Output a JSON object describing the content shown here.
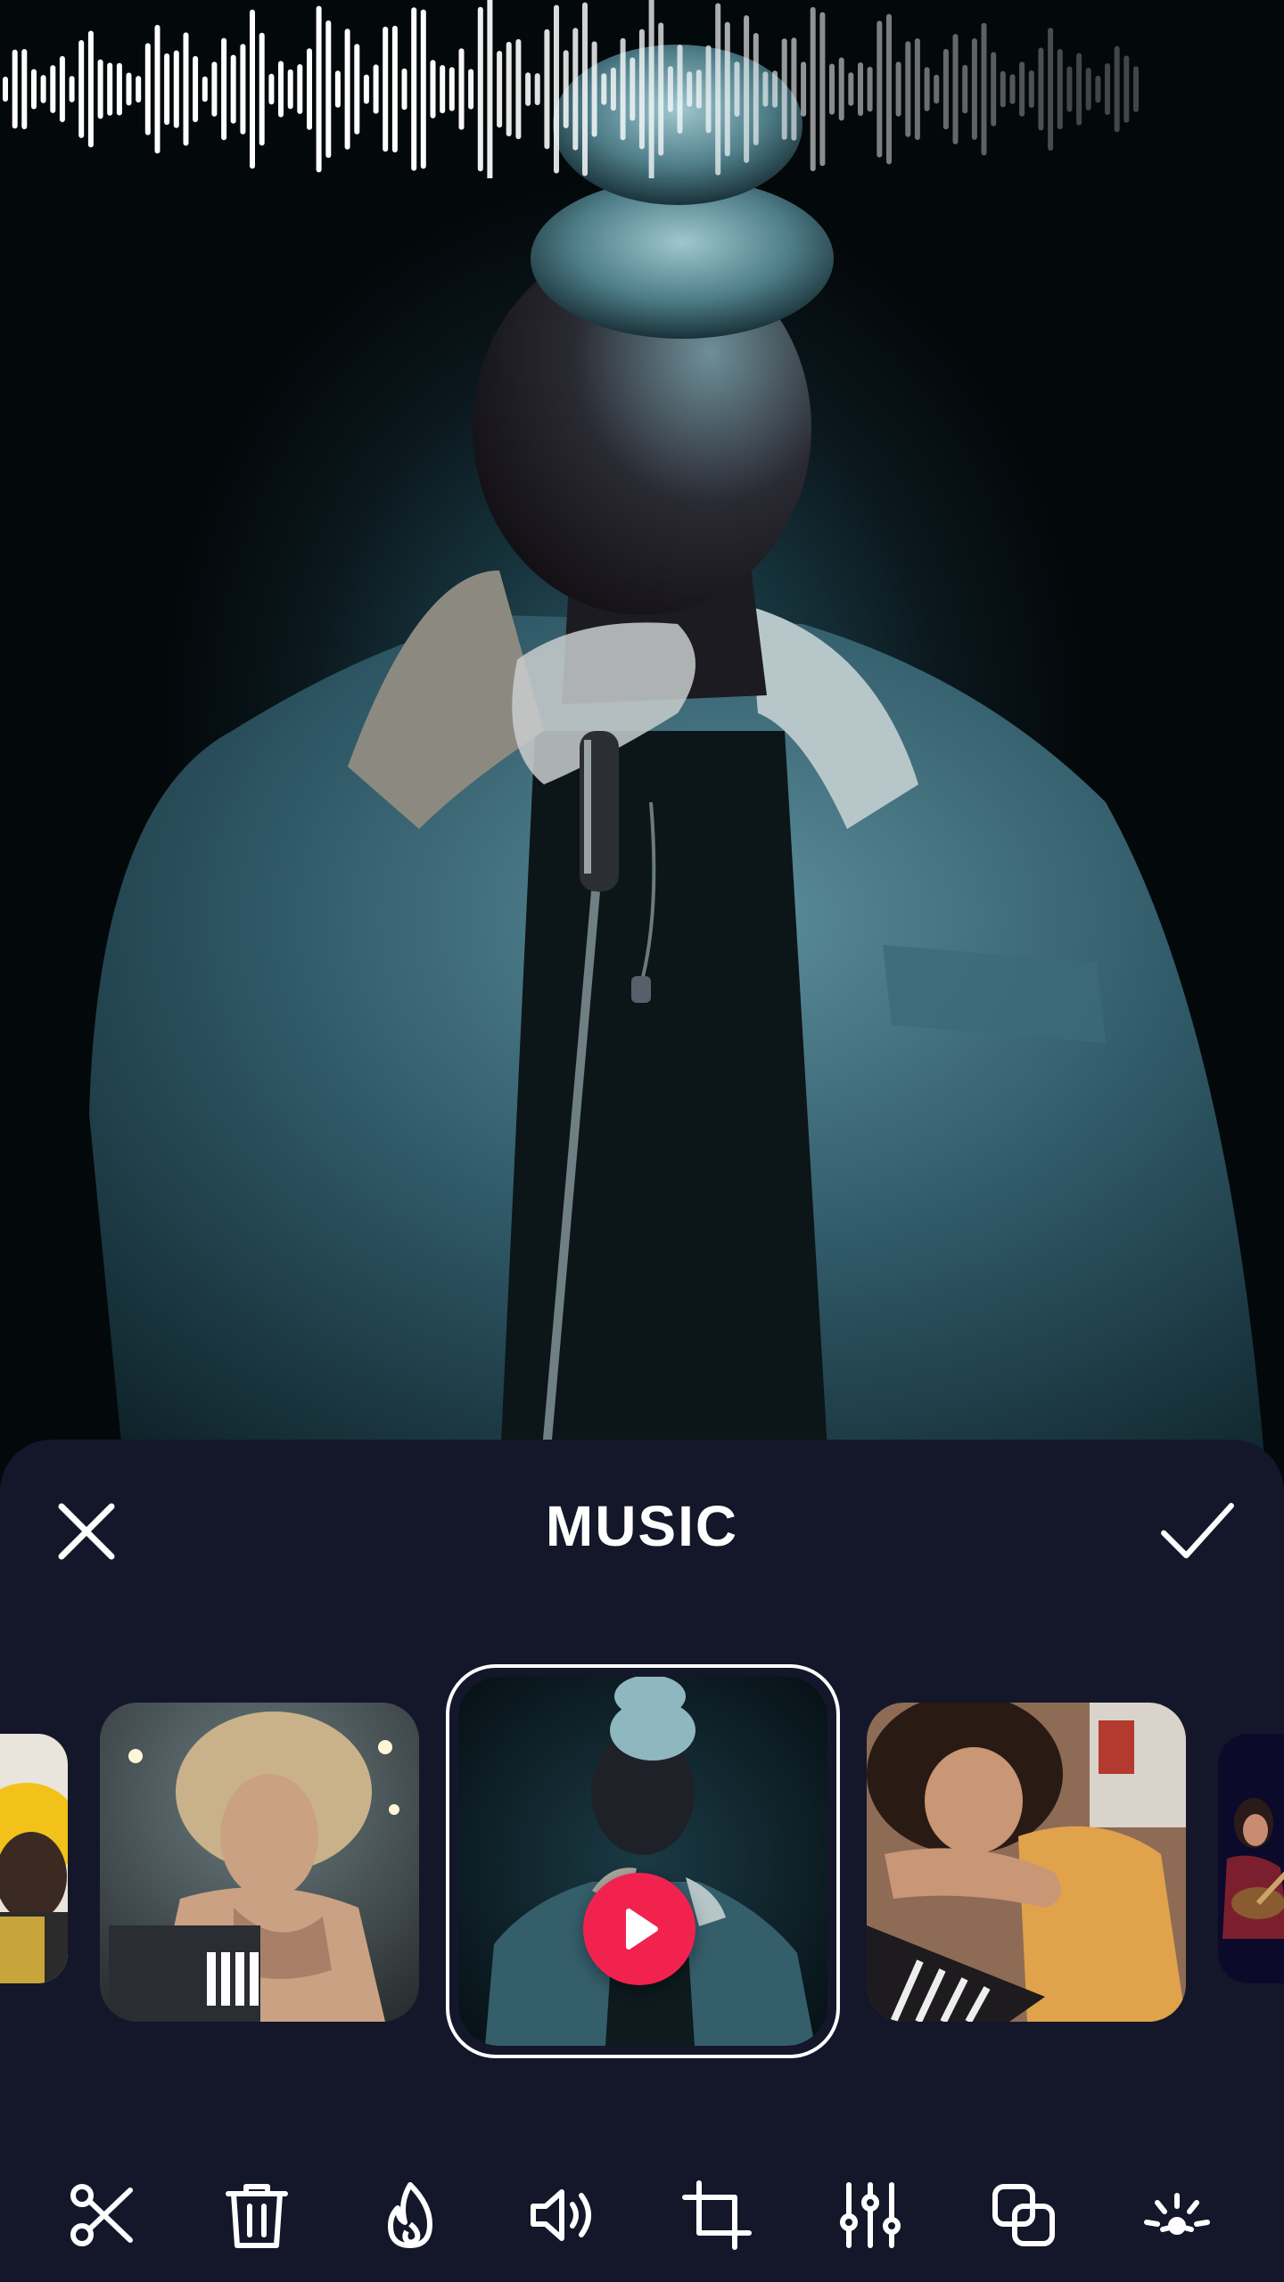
{
  "header": {
    "title": "MUSIC"
  },
  "carousel": {
    "items": [
      {
        "name": "partial-yellow-hair-thumb"
      },
      {
        "name": "curly-hair-woman-thumb"
      },
      {
        "name": "singer-microphone-thumb",
        "selected": true
      },
      {
        "name": "woman-piano-thumb"
      },
      {
        "name": "guitarist-stage-thumb"
      }
    ]
  },
  "toolbar": {
    "tools": [
      "scissors-icon",
      "trash-icon",
      "flame-icon",
      "volume-icon",
      "crop-icon",
      "sliders-icon",
      "overlay-icon",
      "sparkle-icon"
    ]
  },
  "colors": {
    "sheet_bg": "#14172a",
    "accent": "#f2224f",
    "icon": "#ffffff"
  }
}
